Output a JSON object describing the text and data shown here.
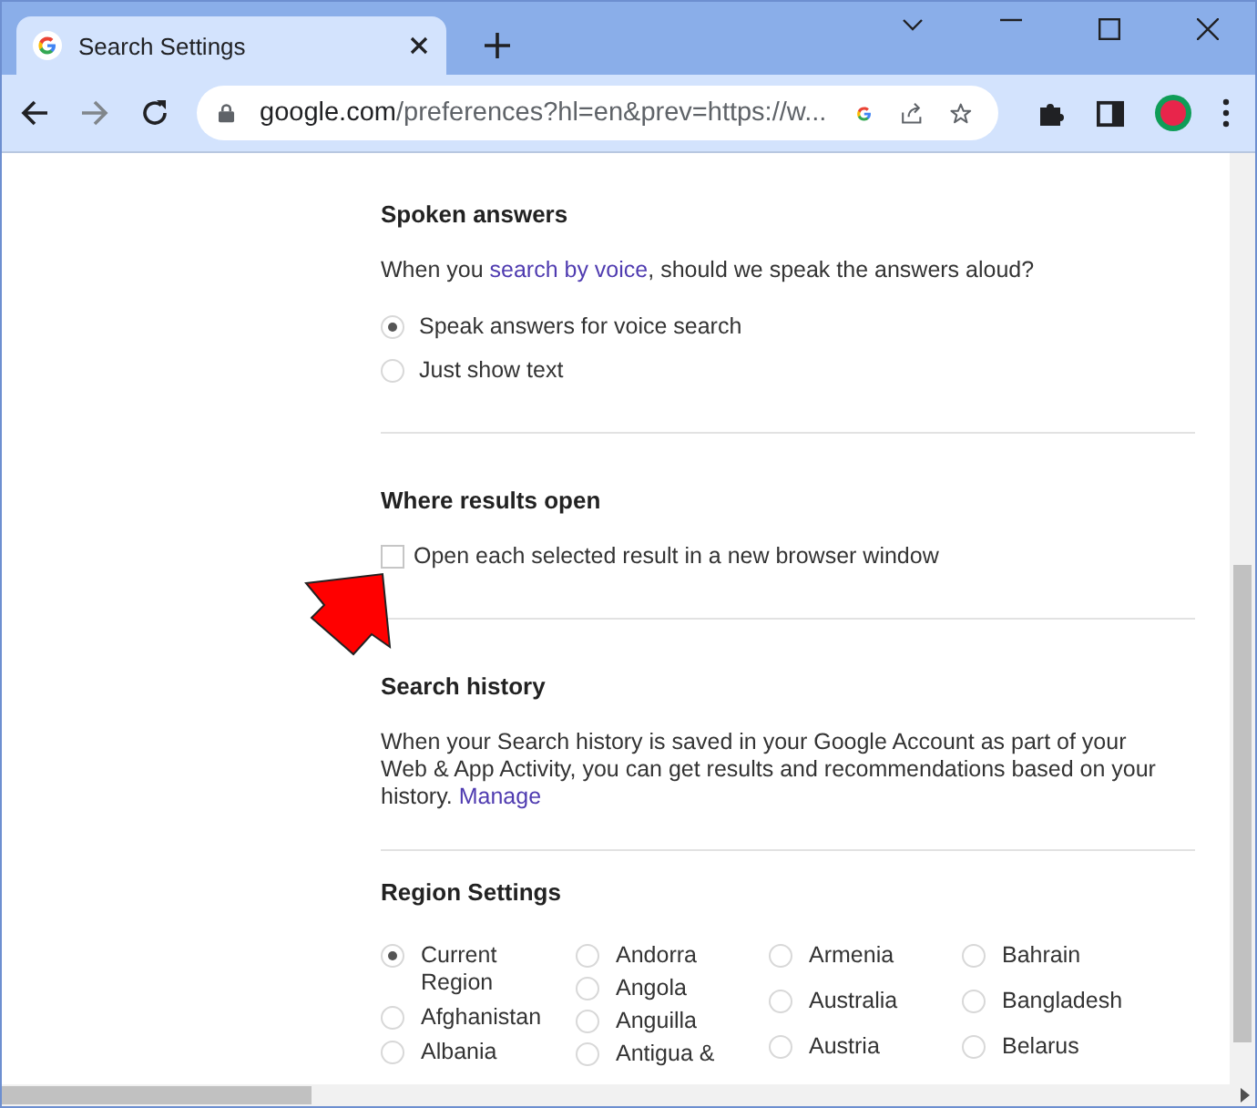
{
  "browser": {
    "tab": {
      "title": "Search Settings"
    },
    "address_bar": {
      "domain": "google.com",
      "path": "/preferences?hl=en&prev=https://w..."
    }
  },
  "spoken_answers": {
    "heading": "Spoken answers",
    "question_before": "When you ",
    "link": "search by voice",
    "question_after": ", should we speak the answers aloud?",
    "options": [
      {
        "label": "Speak answers for voice search",
        "selected": true
      },
      {
        "label": "Just show text",
        "selected": false
      }
    ]
  },
  "where_results_open": {
    "heading": "Where results open",
    "checkbox": {
      "label": "Open each selected result in a new browser window",
      "checked": false
    }
  },
  "search_history": {
    "heading": "Search history",
    "text": "When your Search history is saved in your Google Account as part of your Web & App Activity, you can get results and recommendations based on your history. ",
    "link": "Manage"
  },
  "region_settings": {
    "heading": "Region Settings",
    "columns": [
      [
        {
          "label": "Current Region",
          "selected": true
        },
        {
          "label": "Afghanistan",
          "selected": false
        },
        {
          "label": "Albania",
          "selected": false
        }
      ],
      [
        {
          "label": "Andorra",
          "selected": false
        },
        {
          "label": "Angola",
          "selected": false
        },
        {
          "label": "Anguilla",
          "selected": false
        },
        {
          "label": "Antigua &",
          "selected": false
        }
      ],
      [
        {
          "label": "Armenia",
          "selected": false
        },
        {
          "label": "Australia",
          "selected": false
        },
        {
          "label": "Austria",
          "selected": false
        }
      ],
      [
        {
          "label": "Bahrain",
          "selected": false
        },
        {
          "label": "Bangladesh",
          "selected": false
        },
        {
          "label": "Belarus",
          "selected": false
        }
      ]
    ]
  }
}
